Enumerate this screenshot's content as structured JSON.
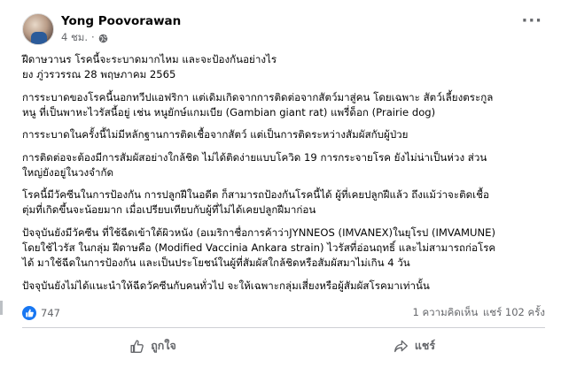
{
  "post": {
    "author": "Yong Poovorawan",
    "time": "4 ชม.",
    "privacy_icon": "globe-icon",
    "more_icon": "more-options-icon"
  },
  "content": {
    "title": "ฝีดาษวานร โรคนี้จะระบาดมากไหม และจะป้องกันอย่างไร",
    "byline": "ยง ภู่วรวรรณ  28 พฤษภาคม 2565",
    "paragraphs": [
      [
        "การระบาดของโรคนี้นอกทวีปแอฟริกา แต่เดิมเกิดจากการติดต่อจากสัตว์มาสู่คน โดยเฉพาะ สัตว์เลี้ยงตระกูล",
        "หนู ที่เป็นพาหะไวรัสนี้อยู่ เช่น หนูยักษ์แกมเบีย (Gambian giant rat) แพรี่ด็อก (Prairie dog)"
      ],
      [
        "การระบาดในครั้งนี้ไม่มีหลักฐานการติดเชื้อจากสัตว์ แต่เป็นการติดระหว่างสัมผัสกับผู้ป่วย"
      ],
      [
        "การติดต่อจะต้องมีการสัมผัสอย่างใกล้ชิด ไม่ได้ติดง่ายแบบโควิด 19 การกระจายโรค ยังไม่น่าเป็นห่วง ส่วน",
        "ใหญ่ยังอยู่ในวงจำกัด"
      ],
      [
        "โรคนี้มีวัคซีนในการป้องกัน การปลูกฝีในอดีต ก็สามารถป้องกันโรคนี้ได้ ผู้ที่เคยปลูกฝีแล้ว ถึงแม้ว่าจะติดเชื้อ",
        "ตุ่มที่เกิดขึ้นจะน้อยมาก เมื่อเปรียบเทียบกับผู้ที่ไม่ได้เคยปลูกฝีมาก่อน"
      ],
      [
        "ปัจจุบันยังมีวัคซีน ที่ใช้ฉีดเข้าใต้ผิวหนัง (อเมริกาชื่อการค้าว่าJYNNEOS (IMVANEX)ในยุโรป (IMVAMUNE)",
        "โดยใช้ไวรัส ในกลุ่ม ฝีดาษคือ (Modified Vaccinia Ankara strain)  ไวรัสที่อ่อนฤทธิ์ และไม่สามารถก่อโรค",
        "ได้ มาใช้ฉีดในการป้องกัน และเป็นประโยชน์ในผู้ที่สัมผัสใกล้ชิดหรือสัมผัสมาไม่เกิน 4 วัน"
      ],
      [
        "ปัจจุบันยังไม่ได้แนะนำให้ฉีดวัคซีนกับคนทั่วไป จะให้เฉพาะกลุ่มเสี่ยงหรือผู้สัมผัสโรคมาเท่านั้น"
      ]
    ]
  },
  "stats": {
    "reaction_icon": "like-icon",
    "reaction_count": "747",
    "comments": "1 ความคิดเห็น",
    "shares": "แชร์ 102 ครั้ง"
  },
  "actions": {
    "like_label": "ถูกใจ",
    "like_icon": "thumbs-up-icon",
    "share_label": "แชร์",
    "share_icon": "share-arrow-icon"
  },
  "colors": {
    "accent": "#1877f2",
    "secondary_text": "#65676b",
    "divider": "#ced0d4"
  }
}
